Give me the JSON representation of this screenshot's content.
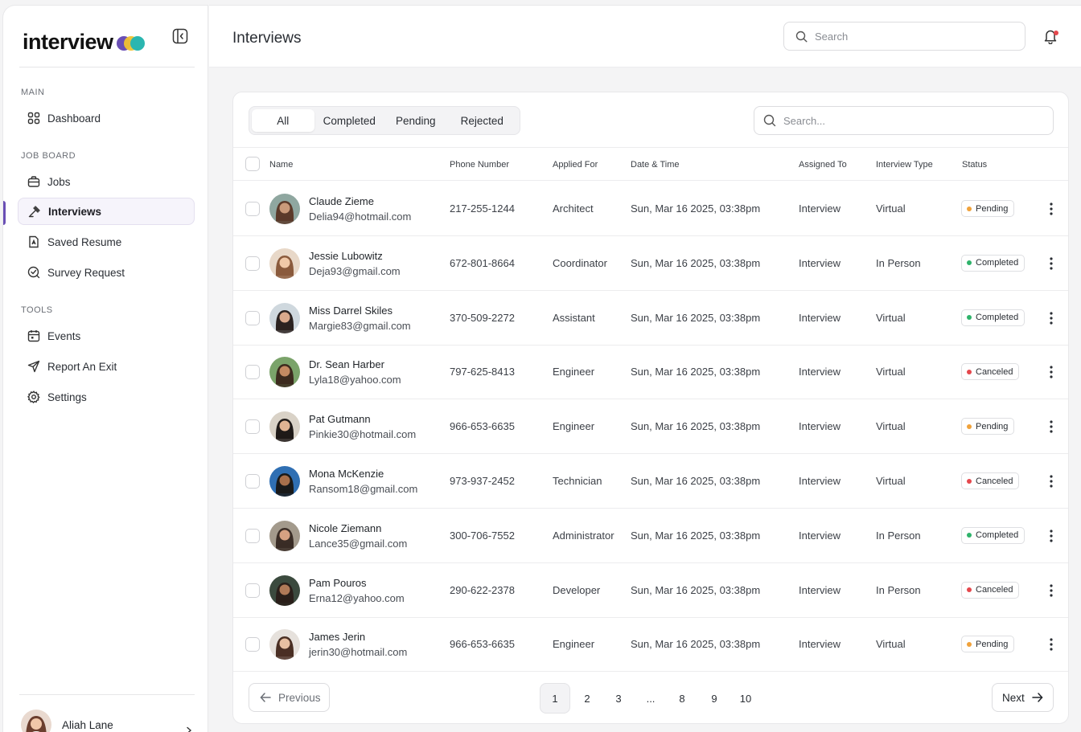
{
  "app": {
    "logo_text": "interview",
    "colors": {
      "purple": "#6a4fb5",
      "yellow": "#f2c230",
      "teal": "#2bb6b0"
    }
  },
  "sidebar": {
    "sections": [
      {
        "label": "MAIN",
        "items": [
          {
            "label": "Dashboard",
            "icon": "grid-icon"
          }
        ]
      },
      {
        "label": "JOB BOARD",
        "items": [
          {
            "label": "Jobs",
            "icon": "briefcase-icon"
          },
          {
            "label": "Interviews",
            "icon": "gavel-icon",
            "active": true
          },
          {
            "label": "Saved Resume",
            "icon": "resume-icon"
          },
          {
            "label": "Survey Request",
            "icon": "survey-icon"
          }
        ]
      },
      {
        "label": "TOOLS",
        "items": [
          {
            "label": "Events",
            "icon": "calendar-icon"
          },
          {
            "label": "Report An Exit",
            "icon": "send-icon"
          },
          {
            "label": "Settings",
            "icon": "gear-icon"
          }
        ]
      }
    ],
    "user": {
      "name": "Aliah Lane"
    }
  },
  "header": {
    "title": "Interviews",
    "search_placeholder": "Search"
  },
  "table": {
    "tabs": [
      "All",
      "Completed",
      "Pending",
      "Rejected"
    ],
    "active_tab": "All",
    "search_placeholder": "Search...",
    "columns": [
      "Name",
      "Phone Number",
      "Applied For",
      "Date & Time",
      "Assigned To",
      "Interview Type",
      "Status"
    ],
    "rows": [
      {
        "name": "Claude Zieme",
        "email": "Delia94@hotmail.com",
        "phone": "217-255-1244",
        "applied": "Architect",
        "datetime": "Sun, Mar 16 2025, 03:38pm",
        "assigned": "Interview",
        "type": "Virtual",
        "status": "Pending"
      },
      {
        "name": "Jessie Lubowitz",
        "email": "Deja93@gmail.com",
        "phone": "672-801-8664",
        "applied": "Coordinator",
        "datetime": "Sun, Mar 16 2025, 03:38pm",
        "assigned": "Interview",
        "type": "In Person",
        "status": "Completed"
      },
      {
        "name": "Miss Darrel Skiles",
        "email": "Margie83@gmail.com",
        "phone": "370-509-2272",
        "applied": "Assistant",
        "datetime": "Sun, Mar 16 2025, 03:38pm",
        "assigned": "Interview",
        "type": "Virtual",
        "status": "Completed"
      },
      {
        "name": "Dr. Sean Harber",
        "email": "Lyla18@yahoo.com",
        "phone": "797-625-8413",
        "applied": "Engineer",
        "datetime": "Sun, Mar 16 2025, 03:38pm",
        "assigned": "Interview",
        "type": "Virtual",
        "status": "Canceled"
      },
      {
        "name": "Pat Gutmann",
        "email": "Pinkie30@hotmail.com",
        "phone": "966-653-6635",
        "applied": "Engineer",
        "datetime": "Sun, Mar 16 2025, 03:38pm",
        "assigned": "Interview",
        "type": "Virtual",
        "status": "Pending"
      },
      {
        "name": "Mona McKenzie",
        "email": "Ransom18@gmail.com",
        "phone": "973-937-2452",
        "applied": "Technician",
        "datetime": "Sun, Mar 16 2025, 03:38pm",
        "assigned": "Interview",
        "type": "Virtual",
        "status": "Canceled"
      },
      {
        "name": "Nicole Ziemann",
        "email": "Lance35@gmail.com",
        "phone": "300-706-7552",
        "applied": "Administrator",
        "datetime": "Sun, Mar 16 2025, 03:38pm",
        "assigned": "Interview",
        "type": "In Person",
        "status": "Completed"
      },
      {
        "name": "Pam Pouros",
        "email": "Erna12@yahoo.com",
        "phone": "290-622-2378",
        "applied": "Developer",
        "datetime": "Sun, Mar 16 2025, 03:38pm",
        "assigned": "Interview",
        "type": "In Person",
        "status": "Canceled"
      },
      {
        "name": "James Jerin",
        "email": "jerin30@hotmail.com",
        "phone": "966-653-6635",
        "applied": "Engineer",
        "datetime": "Sun, Mar 16 2025, 03:38pm",
        "assigned": "Interview",
        "type": "Virtual",
        "status": "Pending"
      }
    ],
    "status_colors": {
      "Pending": "#f0a23b",
      "Completed": "#2fb36b",
      "Canceled": "#e5484d"
    }
  },
  "pagination": {
    "previous_label": "Previous",
    "next_label": "Next",
    "pages": [
      "1",
      "2",
      "3",
      "...",
      "8",
      "9",
      "10"
    ],
    "current": "1"
  }
}
